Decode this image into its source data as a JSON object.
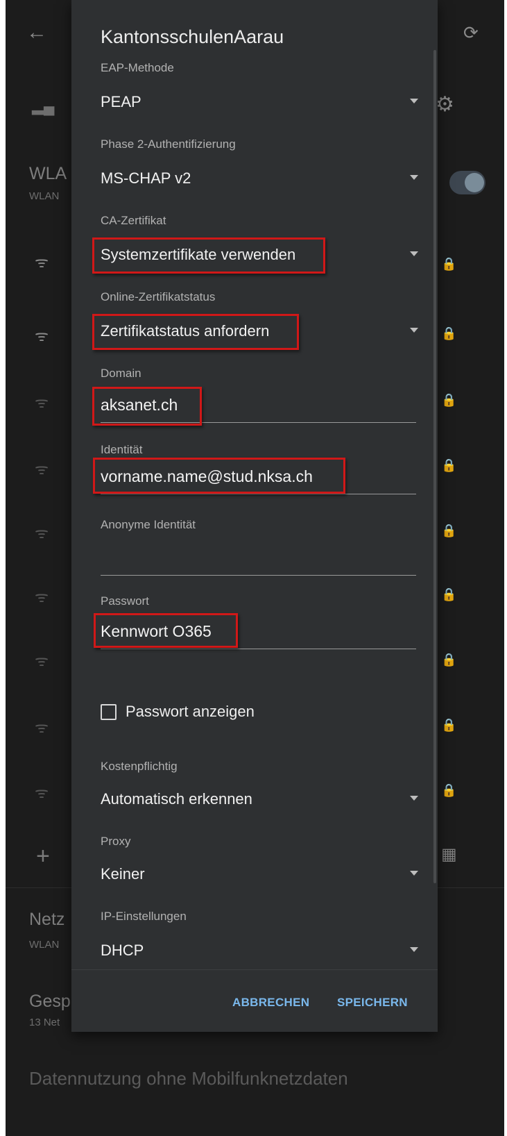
{
  "background": {
    "back_icon": "←",
    "refresh_icon": "⟳",
    "gear_icon": "⚙",
    "signal_icon": "▂▄",
    "wlan_title": "WLA",
    "wlan_sub": "WLAN",
    "networks_title": "Netz",
    "networks_sub": "WLAN",
    "saved_title": "Gesp",
    "saved_sub": "13 Net",
    "footer": "Datennutzung ohne Mobilfunknetzdaten",
    "plus_icon": "+",
    "qr_icon": "▦",
    "wifi_icon": "ᯤ",
    "lock_icon": "🔒"
  },
  "dialog": {
    "title": "KantonsschulenAarau",
    "eap_label": "EAP-Methode",
    "eap_value": "PEAP",
    "phase2_label": "Phase 2-Authentifizierung",
    "phase2_value": "MS-CHAP v2",
    "ca_label": "CA-Zertifikat",
    "ca_value": "Systemzertifikate verwenden",
    "ocsp_label": "Online-Zertifikatstatus",
    "ocsp_value": "Zertifikatstatus anfordern",
    "domain_label": "Domain",
    "domain_value": "aksanet.ch",
    "identity_label": "Identität",
    "identity_value": "vorname.name@stud.nksa.ch",
    "anon_label": "Anonyme Identität",
    "anon_value": "",
    "password_label": "Passwort",
    "password_value": "Kennwort O365",
    "show_password_label": "Passwort anzeigen",
    "metered_label": "Kostenpflichtig",
    "metered_value": "Automatisch erkennen",
    "proxy_label": "Proxy",
    "proxy_value": "Keiner",
    "ip_label": "IP-Einstellungen",
    "ip_value": "DHCP",
    "cancel_label": "ABBRECHEN",
    "save_label": "SPEICHERN"
  },
  "colors": {
    "highlight": "#d01818",
    "accent": "#7ab8ec",
    "dialog_bg": "#2e3032"
  }
}
